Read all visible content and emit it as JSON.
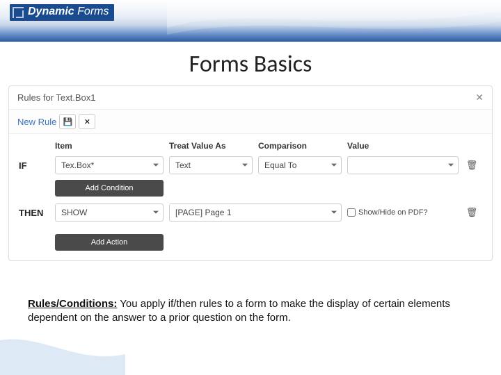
{
  "brand": {
    "logo_prefix": "Dynamic",
    "logo_suffix": " Forms"
  },
  "page_title": "Forms Basics",
  "panel": {
    "title": "Rules for Text.Box1",
    "new_rule": "New Rule",
    "save_icon": "💾",
    "expand_icon": "✕"
  },
  "rule": {
    "if_label": "IF",
    "then_label": "THEN",
    "headers": {
      "item": "Item",
      "treat": "Treat Value As",
      "comparison": "Comparison",
      "value": "Value"
    },
    "condition": {
      "item": "Tex.Box*",
      "treat": "Text",
      "comparison": "Equal To",
      "value": ""
    },
    "add_condition": "Add Condition",
    "action": {
      "verb": "SHOW",
      "target": "[PAGE] Page 1",
      "pdf_label": "Show/Hide on PDF?"
    },
    "add_action": "Add Action",
    "trash": "🗑"
  },
  "caption": {
    "lead": "Rules/Conditions:",
    "body": "   You apply if/then rules to a form to make the display of certain elements dependent on the answer to a prior question on the form."
  }
}
